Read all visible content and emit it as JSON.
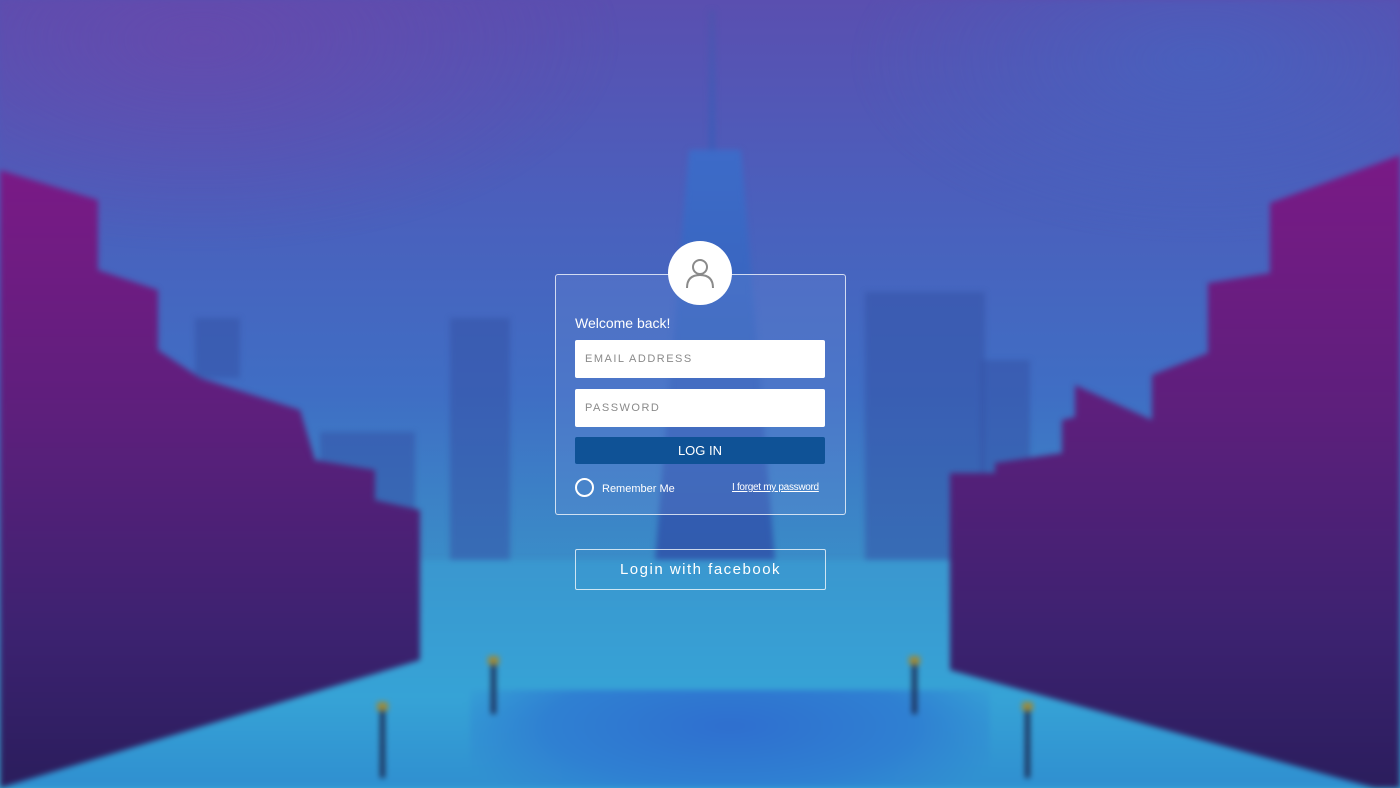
{
  "login": {
    "welcome_text": "Welcome back!",
    "email_placeholder": "EMAIL ADDRESS",
    "password_placeholder": "PASSWORD",
    "login_button": "LOG IN",
    "remember_label": "Remember Me",
    "forgot_link": "I forget my password",
    "facebook_button": "Login with facebook",
    "avatar_icon": "user-icon"
  },
  "colors": {
    "login_button": "#0f5296",
    "card_border": "#ffffff",
    "background_top": "#5a4fb0",
    "background_bottom": "#3aa8d6",
    "buildings": "#7a1a86"
  }
}
